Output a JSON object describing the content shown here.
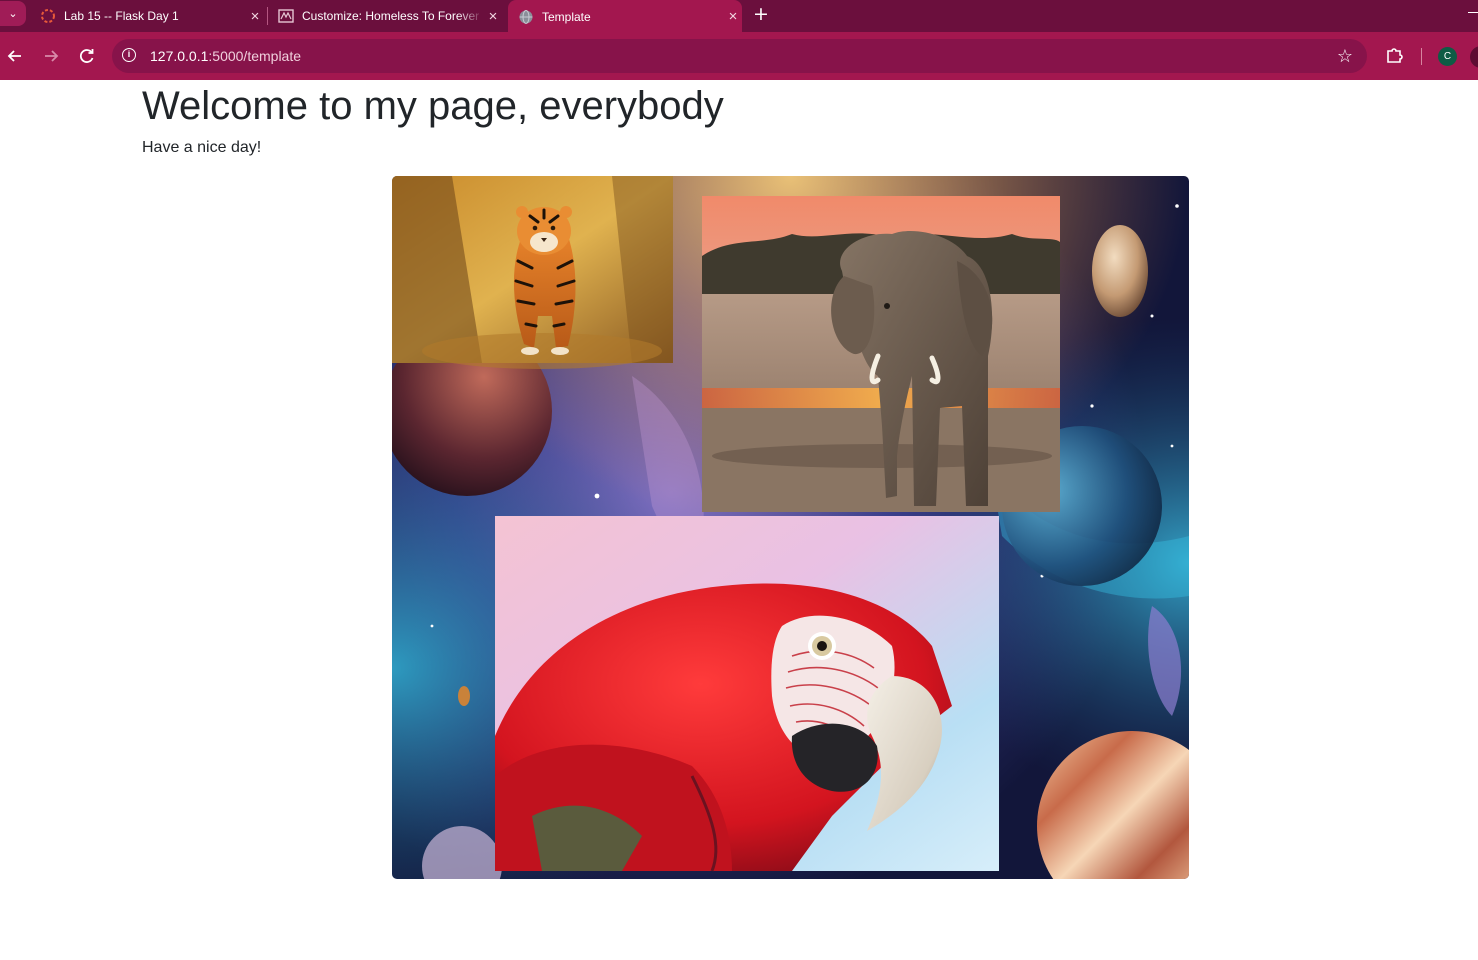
{
  "browser": {
    "tabs": [
      {
        "title": "Lab 15 -- Flask Day 1",
        "active": false
      },
      {
        "title": "Customize: Homeless To Forever",
        "active": false
      },
      {
        "title": "Template",
        "active": true
      }
    ],
    "url_host": "127.0.0.1",
    "url_rest": ":5000/template",
    "profile_initial": "C"
  },
  "page": {
    "heading": "Welcome to my page, everybody",
    "subheading": "Have a nice day!"
  },
  "collage": {
    "background": "space-nebula-with-planets",
    "photos": [
      "tiger",
      "elephant",
      "scarlet-macaw"
    ]
  },
  "colors": {
    "chrome_dark": "#6b0f3d",
    "chrome_toolbar": "#a3174f",
    "text": "#212529"
  }
}
